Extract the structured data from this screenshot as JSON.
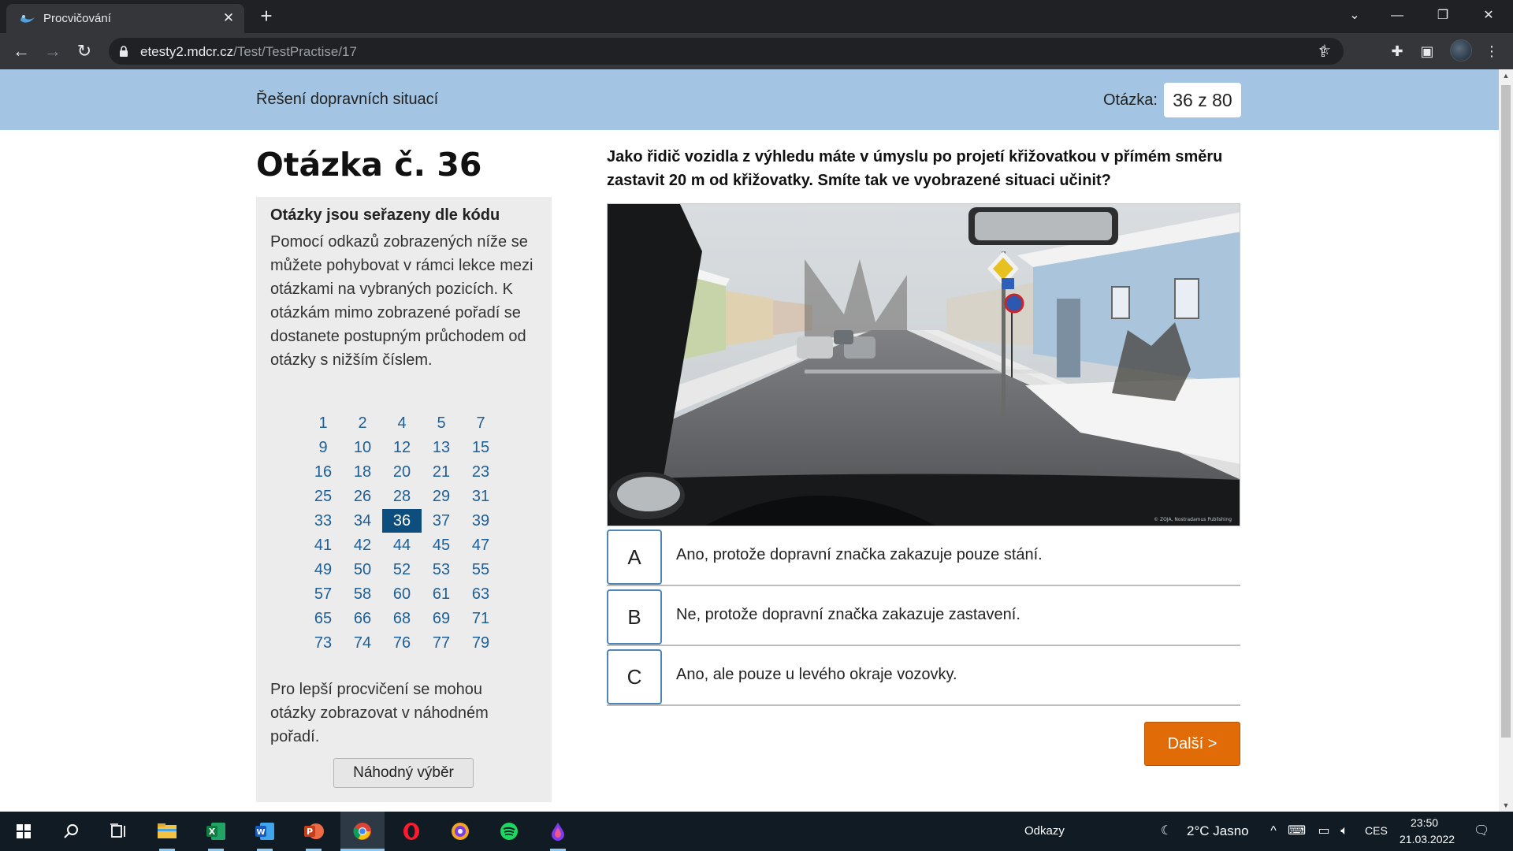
{
  "browser": {
    "tab_title": "Procvičování",
    "url_domain": "etesty2.mdcr.cz",
    "url_path": "/Test/TestPractise/17"
  },
  "header": {
    "title": "Řešení dopravních situací",
    "question_label": "Otázka:",
    "question_counter": "36 z 80"
  },
  "question": {
    "heading": "Otázka č. 36",
    "text": "Jako řidič vozidla z výhledu máte v úmyslu po projetí křižovatkou v přímém směru zastavit 20 m od křižovatky. Smíte tak ve vyobrazené situaci učinit?",
    "image_watermark": "© ZOJA, Nostradamus Publishing"
  },
  "sidebar": {
    "title": "Otázky jsou seřazeny dle kódu",
    "description": "Pomocí odkazů zobrazených níže se můžete pohybovat v rámci lekce mezi otázkami na vybraných pozicích. K otázkám mimo zobrazené pořadí se dostanete postupným průchodem od otázky s nižším číslem.",
    "question_numbers": [
      "1",
      "2",
      "4",
      "5",
      "7",
      "9",
      "10",
      "12",
      "13",
      "15",
      "16",
      "18",
      "20",
      "21",
      "23",
      "25",
      "26",
      "28",
      "29",
      "31",
      "33",
      "34",
      "36",
      "37",
      "39",
      "41",
      "42",
      "44",
      "45",
      "47",
      "49",
      "50",
      "52",
      "53",
      "55",
      "57",
      "58",
      "60",
      "61",
      "63",
      "65",
      "66",
      "68",
      "69",
      "71",
      "73",
      "74",
      "76",
      "77",
      "79"
    ],
    "active_number": "36",
    "note": "Pro lepší procvičení se mohou otázky zobrazovat v náhodném pořadí.",
    "random_button": "Náhodný výběr"
  },
  "answers": [
    {
      "letter": "A",
      "text": "Ano, protože dopravní značka zakazuje pouze stání."
    },
    {
      "letter": "B",
      "text": "Ne, protože dopravní značka zakazuje zastavení."
    },
    {
      "letter": "C",
      "text": "Ano, ale pouze u levého okraje vozovky."
    }
  ],
  "next_button": "Další >",
  "taskbar": {
    "links_label": "Odkazy",
    "weather": "2°C  Jasno",
    "language": "CES",
    "time": "23:50",
    "date": "21.03.2022"
  },
  "colors": {
    "header_bg": "#a3c5e3",
    "active_question": "#0e4e7f",
    "next_button": "#e16b06",
    "answer_border": "#4f86b5"
  }
}
